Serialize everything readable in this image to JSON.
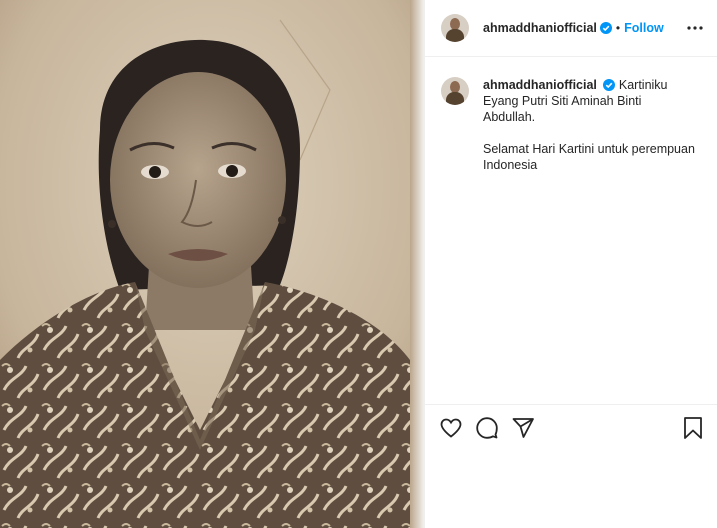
{
  "post": {
    "username": "ahmaddhaniofficial",
    "follow_label": "Follow",
    "separator": "•",
    "caption": {
      "line1": "Kartiniku",
      "line2": "Eyang Putri Siti Aminah Binti",
      "line3": "Abdullah.",
      "line4": "Selamat Hari Kartini untuk perempuan",
      "line5": "Indonesia"
    }
  },
  "icons": {
    "verified": "verified-badge-icon",
    "more": "more-options-icon",
    "like": "heart-icon",
    "comment": "comment-icon",
    "share": "share-icon",
    "save": "bookmark-icon"
  },
  "colors": {
    "accent": "#0095f6",
    "text": "#262626",
    "divider": "#efefef"
  }
}
